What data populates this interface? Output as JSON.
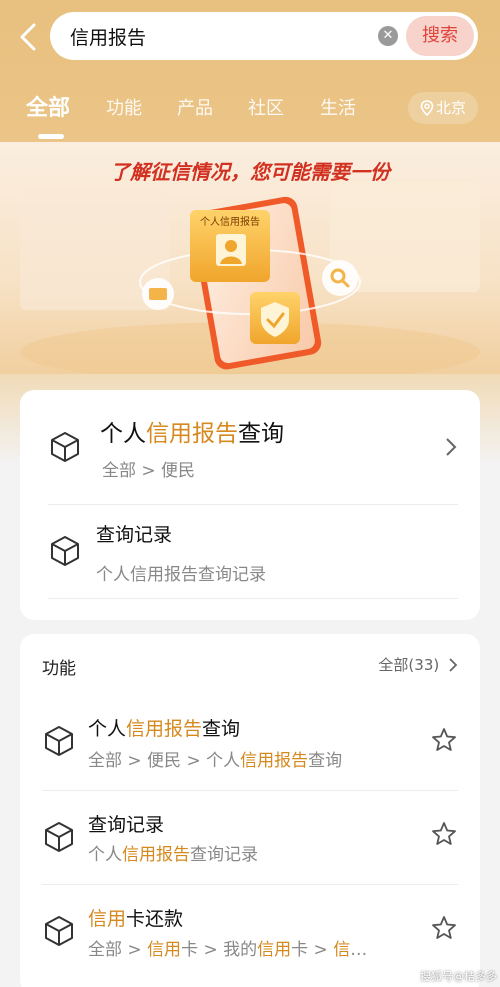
{
  "search": {
    "query": "信用报告",
    "button_label": "搜索"
  },
  "tabs": [
    {
      "label": "全部",
      "active": true
    },
    {
      "label": "功能",
      "active": false
    },
    {
      "label": "产品",
      "active": false
    },
    {
      "label": "社区",
      "active": false
    },
    {
      "label": "生活",
      "active": false
    }
  ],
  "location": "北京",
  "banner": {
    "title": "了解征信情况，您可能需要一份",
    "card_caption": "个人信用报告"
  },
  "top_results": [
    {
      "title_pre": "个人",
      "title_hl": "信用报告",
      "title_post": "查询",
      "sub": "全部 > 便民"
    },
    {
      "title": "查询记录",
      "sub": "个人信用报告查询记录"
    }
  ],
  "functions": {
    "label": "功能",
    "all_link": "全部(33)",
    "items": [
      {
        "title_pre": "个人",
        "title_hl": "信用报告",
        "title_post": "查询",
        "sub_pre": "全部 > 便民 > 个人",
        "sub_hl": "信用报告",
        "sub_post": "查询"
      },
      {
        "title_pre": "查询记录",
        "title_hl": "",
        "title_post": "",
        "sub_pre": "个人",
        "sub_hl": "信用报告",
        "sub_post": "查询记录"
      },
      {
        "title_pre": "",
        "title_hl": "信用",
        "title_post": "卡还款",
        "sub_pre": "全部 > ",
        "sub_hl": "信用",
        "sub_mid": "卡 > 我的",
        "sub_hl2": "信用",
        "sub_mid2": "卡 > ",
        "sub_hl3": "信",
        "sub_post": "…"
      }
    ]
  },
  "watermark": "搜狐号@桔多多",
  "colors": {
    "accent_orange": "#d5891f",
    "search_btn_text": "#e0433a",
    "header_bg": "#e8c07f"
  }
}
